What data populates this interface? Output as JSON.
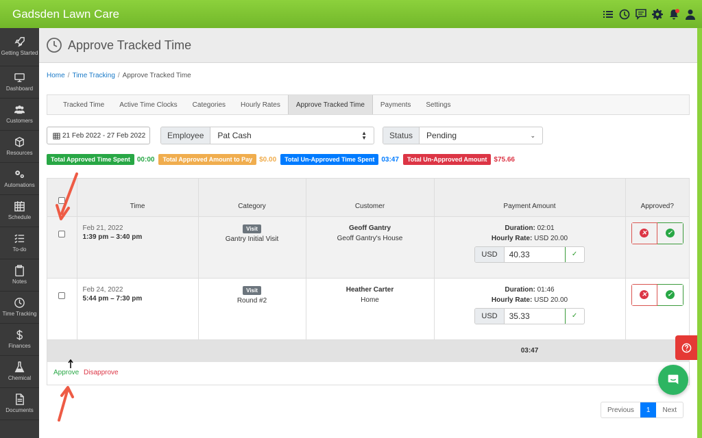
{
  "app": {
    "title": "Gadsden Lawn Care"
  },
  "colors": {
    "brand": "#7cc433",
    "sidebar": "#3a3a3a",
    "success": "#28a745",
    "warning": "#f0ad4e",
    "info": "#007bff",
    "danger": "#dc3545"
  },
  "topbar_icons": [
    "checklist-icon",
    "clock-icon",
    "chat-icon",
    "gear-icon",
    "bell-icon",
    "user-icon"
  ],
  "sidebar": {
    "items": [
      {
        "label": "Getting Started",
        "icon": "rocket-icon"
      },
      {
        "label": "Dashboard",
        "icon": "monitor-icon"
      },
      {
        "label": "Customers",
        "icon": "users-icon"
      },
      {
        "label": "Resources",
        "icon": "cube-icon"
      },
      {
        "label": "Automations",
        "icon": "gears-icon"
      },
      {
        "label": "Schedule",
        "icon": "calendar-icon"
      },
      {
        "label": "To-do",
        "icon": "list-icon"
      },
      {
        "label": "Notes",
        "icon": "clipboard-icon"
      },
      {
        "label": "Time Tracking",
        "icon": "clock-icon"
      },
      {
        "label": "Finances",
        "icon": "dollar-icon"
      },
      {
        "label": "Chemical",
        "icon": "flask-icon"
      },
      {
        "label": "Documents",
        "icon": "document-icon"
      }
    ]
  },
  "page": {
    "title": "Approve Tracked Time"
  },
  "breadcrumb": {
    "home": "Home",
    "section": "Time Tracking",
    "current": "Approve Tracked Time"
  },
  "tabs": [
    "Tracked Time",
    "Active Time Clocks",
    "Categories",
    "Hourly Rates",
    "Approve Tracked Time",
    "Payments",
    "Settings"
  ],
  "filters": {
    "date_range": "21 Feb 2022 - 27 Feb 2022",
    "employee_label": "Employee",
    "employee_value": "Pat Cash",
    "status_label": "Status",
    "status_value": "Pending"
  },
  "summary": {
    "approved_time_label": "Total Approved Time Spent",
    "approved_time_value": "00:00",
    "approved_pay_label": "Total Approved Amount to Pay",
    "approved_pay_value": "$0.00",
    "unapproved_time_label": "Total Un-Approved Time Spent",
    "unapproved_time_value": "03:47",
    "unapproved_amount_label": "Total Un-Approved Amount",
    "unapproved_amount_value": "$75.66"
  },
  "table": {
    "headers": {
      "time": "Time",
      "category": "Category",
      "customer": "Customer",
      "payment": "Payment Amount",
      "approved": "Approved?"
    },
    "rows": [
      {
        "date": "Feb 21, 2022",
        "time": "1:39 pm – 3:40 pm",
        "badge": "Visit",
        "category": "Gantry Initial Visit",
        "customer": "Geoff Gantry",
        "location": "Geoff Gantry's House",
        "duration_label": "Duration:",
        "duration": "02:01",
        "rate_label": "Hourly Rate:",
        "rate": "USD 20.00",
        "currency": "USD",
        "amount": "40.33"
      },
      {
        "date": "Feb 24, 2022",
        "time": "5:44 pm – 7:30 pm",
        "badge": "Visit",
        "category": "Round #2",
        "customer": "Heather Carter",
        "location": "Home",
        "duration_label": "Duration:",
        "duration": "01:46",
        "rate_label": "Hourly Rate:",
        "rate": "USD 20.00",
        "currency": "USD",
        "amount": "35.33"
      }
    ],
    "total_time": "03:47"
  },
  "actions": {
    "approve": "Approve",
    "disapprove": "Disapprove"
  },
  "pagination": {
    "previous": "Previous",
    "current": "1",
    "next": "Next"
  }
}
